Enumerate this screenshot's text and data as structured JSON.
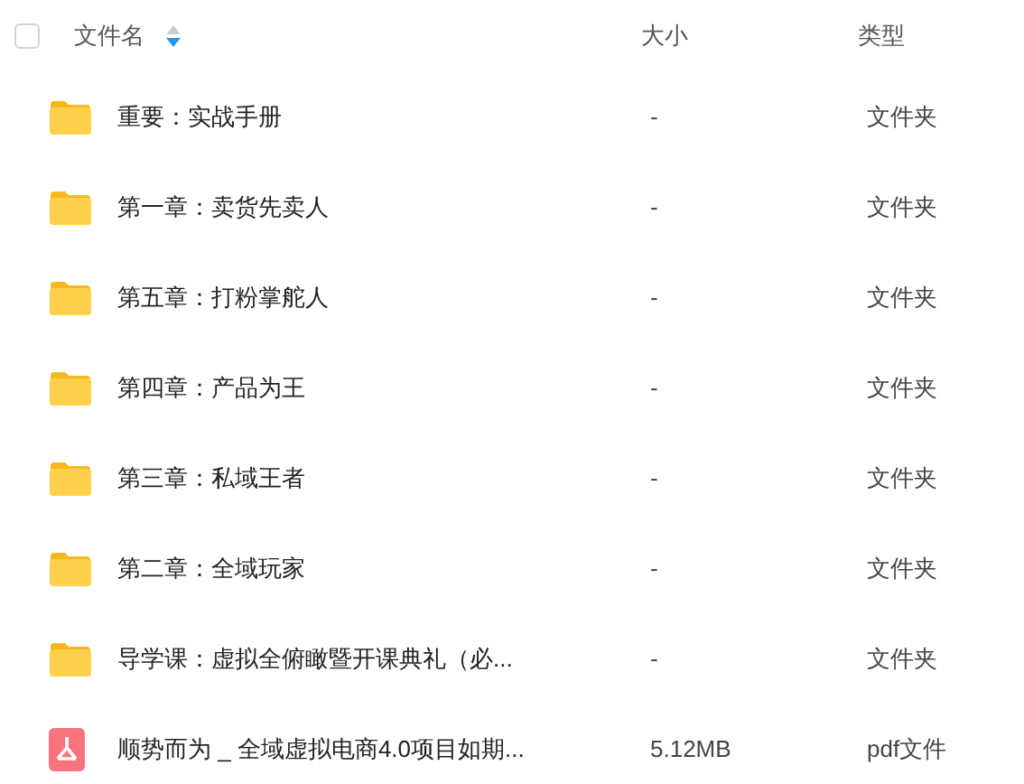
{
  "header": {
    "select_all_checked": false,
    "columns": [
      {
        "label": "文件名",
        "sorted": true
      },
      {
        "label": "大小",
        "sorted": false
      },
      {
        "label": "类型",
        "sorted": false
      }
    ]
  },
  "rows": [
    {
      "kind": "folder",
      "name": "重要：实战手册",
      "size": "-",
      "type": "文件夹"
    },
    {
      "kind": "folder",
      "name": "第一章：卖货先卖人",
      "size": "-",
      "type": "文件夹"
    },
    {
      "kind": "folder",
      "name": "第五章：打粉掌舵人",
      "size": "-",
      "type": "文件夹"
    },
    {
      "kind": "folder",
      "name": "第四章：产品为王",
      "size": "-",
      "type": "文件夹"
    },
    {
      "kind": "folder",
      "name": "第三章：私域王者",
      "size": "-",
      "type": "文件夹"
    },
    {
      "kind": "folder",
      "name": "第二章：全域玩家",
      "size": "-",
      "type": "文件夹"
    },
    {
      "kind": "folder",
      "name": "导学课：虚拟全俯瞰暨开课典礼（必...",
      "size": "-",
      "type": "文件夹"
    },
    {
      "kind": "pdf",
      "name": "顺势而为 _ 全域虚拟电商4.0项目如期...",
      "size": "5.12MB",
      "type": "pdf文件"
    }
  ]
}
